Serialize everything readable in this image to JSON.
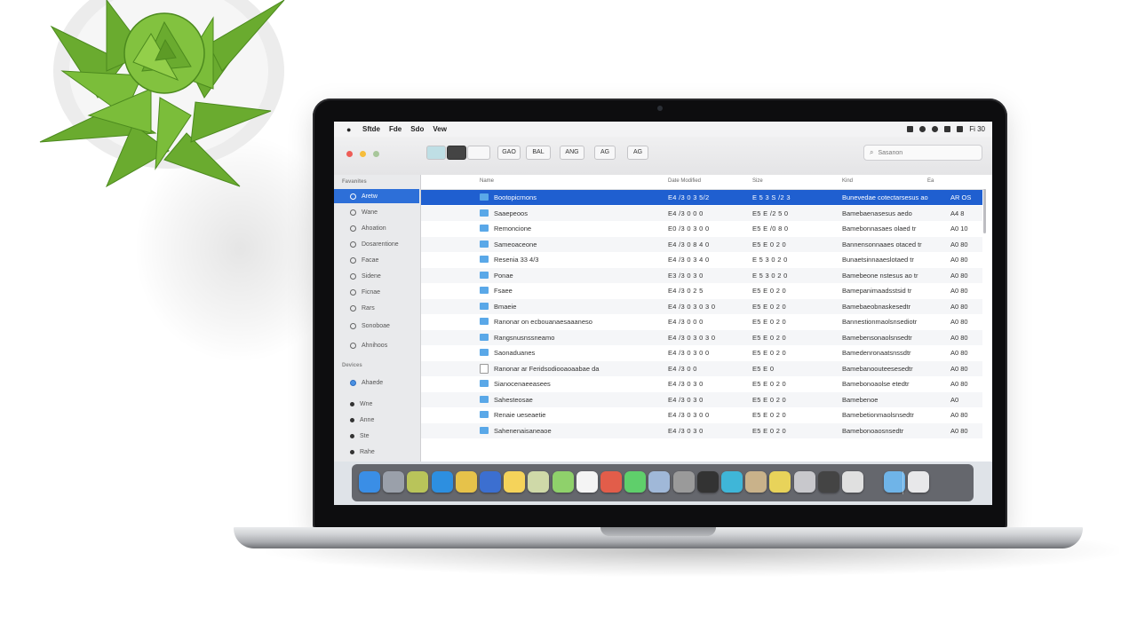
{
  "menubar": {
    "apple": "",
    "items": [
      "Sftde",
      "Fde",
      "Sdo",
      "Vew"
    ],
    "right": [
      "Fi 30"
    ]
  },
  "toolbar": {
    "buttons": [
      "",
      "",
      "",
      "GAO",
      "BAL",
      "ANG",
      "AG",
      "AG"
    ],
    "search_placeholder": "Sasanon"
  },
  "sidebar": {
    "section1": "Favanites",
    "items": [
      "Aretw",
      "Wane",
      "Ahoation",
      "Dosarentione",
      "Facae",
      "Sidene",
      "Ficnae",
      "Rars",
      "Sonoboae",
      "Ahnihoos"
    ],
    "section2": "Devices",
    "devices": [
      "Ahaede",
      "Wne",
      "Anne",
      "Ste",
      "Rahe"
    ]
  },
  "columns": {
    "name": "Name",
    "date": "Date Modified",
    "size": "Size",
    "kind": "Kind",
    "ext": "Ea"
  },
  "rows": [
    {
      "name": "Bootopicrnons",
      "date": "E4 /3 0 3 5/2",
      "size": "E 5 3 S /2 3",
      "kind": "Bunevedae cotectarsesus ao",
      "ext": "AR OS",
      "type": "folder"
    },
    {
      "name": "Saaepeoos",
      "date": "E4 /3 0 0 0",
      "size": "E5 E /2 5 0",
      "kind": "Bamebaenasesus aedo",
      "ext": "A4 8",
      "type": "folder"
    },
    {
      "name": "Remoncione",
      "date": "E0 /3 0 3 0 0",
      "size": "E5 E /0 8 0",
      "kind": "Bamebonnasaes olaed tr",
      "ext": "A0 10",
      "type": "folder"
    },
    {
      "name": "Sameoaceone",
      "date": "E4 /3 0 8 4 0",
      "size": "E5 E 0 2 0",
      "kind": "Bannensonnaaes otaced tr",
      "ext": "A0 80",
      "type": "folder"
    },
    {
      "name": "Resenia 33 4/3",
      "date": "E4 /3 0 3 4 0",
      "size": "E 5 3 0 2 0",
      "kind": "Bunaetsinnaaeslotaed tr",
      "ext": "A0 80",
      "type": "folder"
    },
    {
      "name": "Ponae",
      "date": "E3 /3 0 3 0",
      "size": "E 5 3 0 2 0",
      "kind": "Bamebeone nstesus ao tr",
      "ext": "A0 80",
      "type": "folder"
    },
    {
      "name": "Fsaee",
      "date": "E4 /3 0 2 5",
      "size": "E5 E 0 2 0",
      "kind": "Bamepanimaadsstsid tr",
      "ext": "A0 80",
      "type": "folder"
    },
    {
      "name": "Bmaeie",
      "date": "E4 /3 0 3 0 3 0",
      "size": "E5 E 0 2 0",
      "kind": "Bamebaeobnaskesedtr",
      "ext": "A0 80",
      "type": "folder"
    },
    {
      "name": "Ranonar on ecbouanaesaaaneso",
      "date": "E4 /3 0 0 0",
      "size": "E5 E 0 2 0",
      "kind": "Bannestionmaolsnsediotr",
      "ext": "A0 80",
      "type": "folder"
    },
    {
      "name": "Rangsnusnssneamo",
      "date": "E4 /3 0 3 0 3 0",
      "size": "E5 E 0 2 0",
      "kind": "Bamebensonaolsnsedtr",
      "ext": "A0 80",
      "type": "folder"
    },
    {
      "name": "Saonaduanes",
      "date": "E4 /3 0 3 0 0",
      "size": "E5 E 0 2 0",
      "kind": "Bamedenronaatsnssdtr",
      "ext": "A0 80",
      "type": "folder"
    },
    {
      "name": "Ranonar ar Feridsodiooaoaabae da",
      "date": "E4 /3 0 0",
      "size": "E5 E 0",
      "kind": "Bamebanoouteesesedtr",
      "ext": "A0 80",
      "type": "doc"
    },
    {
      "name": "Sianocenaeeasees",
      "date": "E4 /3 0 3 0",
      "size": "E5 E 0 2 0",
      "kind": "Bamebonoaolse etedtr",
      "ext": "A0 80",
      "type": "folder"
    },
    {
      "name": "Sahesteosae",
      "date": "E4 /3 0 3 0",
      "size": "E5 E 0 2 0",
      "kind": "Bamebenoe",
      "ext": "A0",
      "type": "folder"
    },
    {
      "name": "Renaie ueseaetie",
      "date": "E4 /3 0 3 0 0",
      "size": "E5 E 0 2 0",
      "kind": "Bamebetionmaolsnsedtr",
      "ext": "A0 80",
      "type": "folder"
    },
    {
      "name": "Sahenenaisaneaoe",
      "date": "E4 /3 0 3 0",
      "size": "E5 E 0 2 0",
      "kind": "Bamebonoaosnsedtr",
      "ext": "A0 80",
      "type": "folder"
    }
  ],
  "dock": {
    "icons": [
      "finder-icon",
      "siri-icon",
      "launchpad-icon",
      "safari-icon",
      "chrome-icon",
      "xcode-icon",
      "notes-icon",
      "maps-icon",
      "numbers-icon",
      "pages-icon",
      "calendar-icon",
      "messages-icon",
      "photos-icon",
      "system-preferences-icon",
      "terminal-icon",
      "preview-icon",
      "contacts-icon",
      "textedit-icon",
      "notes-alt-icon",
      "grapher-icon",
      "screenshot-icon",
      "downloads-folder-icon",
      "trash-icon"
    ]
  }
}
